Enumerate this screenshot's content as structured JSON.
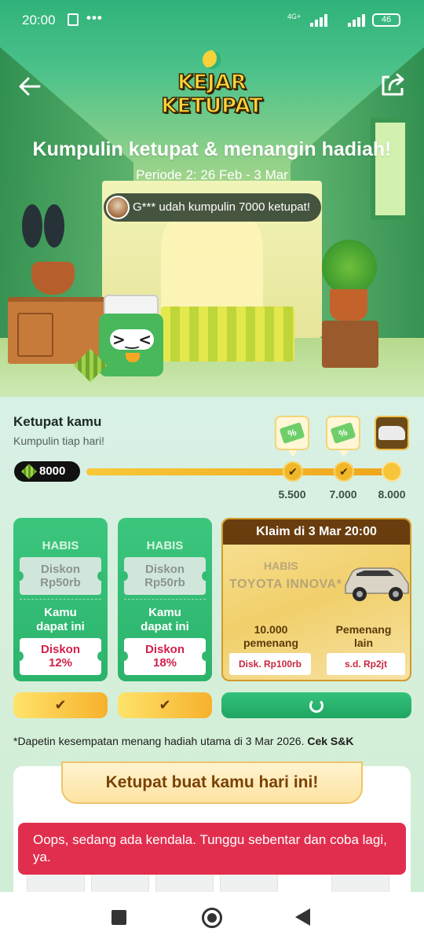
{
  "status_bar": {
    "time": "20:00",
    "more": "•••",
    "network_top": "4G+",
    "network_bottom": "4l",
    "battery": "46"
  },
  "header": {
    "logo_line1": "KEJAR",
    "logo_line2": "KETUPAT",
    "title": "Kumpulin ketupat & menangin hadiah!",
    "period": "Periode 2: 26 Feb - 3 Mar",
    "ticker": "G*** udah kumpulin 7000 ketupat!"
  },
  "progress": {
    "title": "Ketupat kamu",
    "subtitle": "Kumpulin tiap hari!",
    "count": "8000",
    "fill_fraction": 1.0,
    "milestones": [
      {
        "label": "5.500",
        "reached": true,
        "icon": "discount-tag-icon"
      },
      {
        "label": "7.000",
        "reached": true,
        "icon": "discount-tag-icon"
      },
      {
        "label": "8.000",
        "reached": true,
        "icon": "car-prize-icon"
      }
    ],
    "check_glyph": "✔"
  },
  "cards": [
    {
      "status": "HABIS",
      "coupon_line1": "Diskon",
      "coupon_line2": "Rp50rb",
      "you_get_line1": "Kamu",
      "you_get_line2": "dapat ini",
      "reward_line1": "Diskon",
      "reward_line2": "12%"
    },
    {
      "status": "HABIS",
      "coupon_line1": "Diskon",
      "coupon_line2": "Rp50rb",
      "you_get_line1": "Kamu",
      "you_get_line2": "dapat ini",
      "reward_line1": "Diskon",
      "reward_line2": "18%"
    }
  ],
  "grand_card": {
    "claim": "Klaim di 3 Mar 20:00",
    "status": "HABIS",
    "prize": "TOYOTA INNOVA*",
    "col1_line1": "10.000",
    "col1_line2": "pemenang",
    "col2_line1": "Pemenang",
    "col2_line2": "lain",
    "coupon1": "Disk. Rp100rb",
    "coupon2": "s.d. Rp2jt"
  },
  "footnote": {
    "text": "*Dapetin kesempatan menang hadiah utama di 3 Mar 2026. ",
    "link": "Cek S&K"
  },
  "daily": {
    "title": "Ketupat buat kamu hari ini!"
  },
  "toast": {
    "message": "Oops, sedang ada kendala. Tunggu sebentar dan coba lagi, ya."
  },
  "colors": {
    "brand_green": "#2bb36c",
    "gold": "#f6b12c",
    "error_red": "#e12e4e"
  }
}
